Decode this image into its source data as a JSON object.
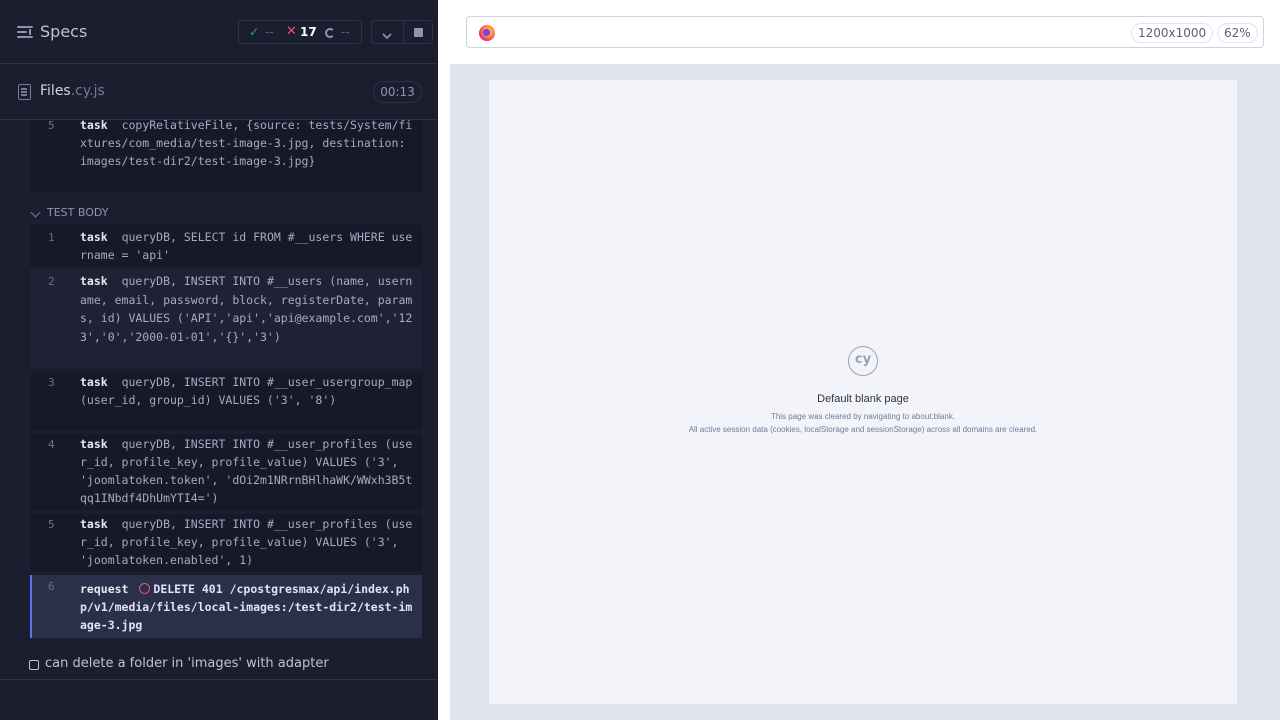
{
  "header": {
    "title": "Specs",
    "passed": "--",
    "failed": "17",
    "pending": "--"
  },
  "spec": {
    "name": "Files",
    "ext": ".cy.js",
    "duration": "00:13"
  },
  "hook_prev": {
    "num": "5",
    "cmd": "task",
    "msg": "copyRelativeFile, {source: tests/System/fixtures/com_media/test-image-3.jpg, destination: images/test-dir2/test-image-3.jpg}"
  },
  "test_body": {
    "label": "TEST BODY",
    "commands": [
      {
        "num": "1",
        "cmd": "task",
        "msg": "queryDB, SELECT id FROM #__users WHERE username = 'api'"
      },
      {
        "num": "2",
        "cmd": "task",
        "msg": "queryDB, INSERT INTO #__users (name, username, email, password, block, registerDate, params, id) VALUES ('API','api','api@example.com','123','0','2000-01-01','{}','3')"
      },
      {
        "num": "3",
        "cmd": "task",
        "msg": "queryDB, INSERT INTO #__user_usergroup_map (user_id, group_id) VALUES ('3', '8')"
      },
      {
        "num": "4",
        "cmd": "task",
        "msg": "queryDB, INSERT INTO #__user_profiles (user_id, profile_key, profile_value) VALUES ('3', 'joomlatoken.token', 'dOi2m1NRrnBHlhaWK/WWxh3B5tqq1INbdf4DhUmYTI4=')"
      },
      {
        "num": "5",
        "cmd": "task",
        "msg": "queryDB, INSERT INTO #__user_profiles (user_id, profile_key, profile_value) VALUES ('3', 'joomlatoken.enabled', 1)"
      },
      {
        "num": "6",
        "cmd": "request",
        "msg": "DELETE 401 /cpostgresmax/api/index.php/v1/media/files/local-images:/test-dir2/test-image-3.jpg"
      }
    ]
  },
  "next_test": {
    "label": "can delete a folder in 'images' with adapter"
  },
  "aut": {
    "viewport": "1200x1000",
    "zoom": "62%",
    "logo_text": "cy",
    "blank_title": "Default blank page",
    "blank_line1": "This page was cleared by navigating to about:blank.",
    "blank_line2": "All active session data (cookies, localStorage and sessionStorage) across all domains are cleared."
  }
}
